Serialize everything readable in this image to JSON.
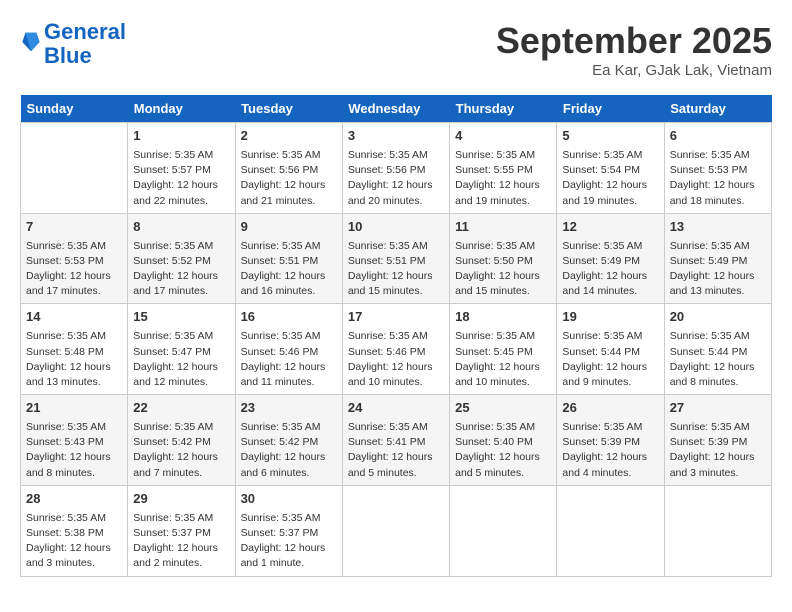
{
  "header": {
    "logo_line1": "General",
    "logo_line2": "Blue",
    "month": "September 2025",
    "location": "Ea Kar, GJak Lak, Vietnam"
  },
  "weekdays": [
    "Sunday",
    "Monday",
    "Tuesday",
    "Wednesday",
    "Thursday",
    "Friday",
    "Saturday"
  ],
  "weeks": [
    [
      {
        "day": "",
        "info": ""
      },
      {
        "day": "1",
        "info": "Sunrise: 5:35 AM\nSunset: 5:57 PM\nDaylight: 12 hours\nand 22 minutes."
      },
      {
        "day": "2",
        "info": "Sunrise: 5:35 AM\nSunset: 5:56 PM\nDaylight: 12 hours\nand 21 minutes."
      },
      {
        "day": "3",
        "info": "Sunrise: 5:35 AM\nSunset: 5:56 PM\nDaylight: 12 hours\nand 20 minutes."
      },
      {
        "day": "4",
        "info": "Sunrise: 5:35 AM\nSunset: 5:55 PM\nDaylight: 12 hours\nand 19 minutes."
      },
      {
        "day": "5",
        "info": "Sunrise: 5:35 AM\nSunset: 5:54 PM\nDaylight: 12 hours\nand 19 minutes."
      },
      {
        "day": "6",
        "info": "Sunrise: 5:35 AM\nSunset: 5:53 PM\nDaylight: 12 hours\nand 18 minutes."
      }
    ],
    [
      {
        "day": "7",
        "info": "Sunrise: 5:35 AM\nSunset: 5:53 PM\nDaylight: 12 hours\nand 17 minutes."
      },
      {
        "day": "8",
        "info": "Sunrise: 5:35 AM\nSunset: 5:52 PM\nDaylight: 12 hours\nand 17 minutes."
      },
      {
        "day": "9",
        "info": "Sunrise: 5:35 AM\nSunset: 5:51 PM\nDaylight: 12 hours\nand 16 minutes."
      },
      {
        "day": "10",
        "info": "Sunrise: 5:35 AM\nSunset: 5:51 PM\nDaylight: 12 hours\nand 15 minutes."
      },
      {
        "day": "11",
        "info": "Sunrise: 5:35 AM\nSunset: 5:50 PM\nDaylight: 12 hours\nand 15 minutes."
      },
      {
        "day": "12",
        "info": "Sunrise: 5:35 AM\nSunset: 5:49 PM\nDaylight: 12 hours\nand 14 minutes."
      },
      {
        "day": "13",
        "info": "Sunrise: 5:35 AM\nSunset: 5:49 PM\nDaylight: 12 hours\nand 13 minutes."
      }
    ],
    [
      {
        "day": "14",
        "info": "Sunrise: 5:35 AM\nSunset: 5:48 PM\nDaylight: 12 hours\nand 13 minutes."
      },
      {
        "day": "15",
        "info": "Sunrise: 5:35 AM\nSunset: 5:47 PM\nDaylight: 12 hours\nand 12 minutes."
      },
      {
        "day": "16",
        "info": "Sunrise: 5:35 AM\nSunset: 5:46 PM\nDaylight: 12 hours\nand 11 minutes."
      },
      {
        "day": "17",
        "info": "Sunrise: 5:35 AM\nSunset: 5:46 PM\nDaylight: 12 hours\nand 10 minutes."
      },
      {
        "day": "18",
        "info": "Sunrise: 5:35 AM\nSunset: 5:45 PM\nDaylight: 12 hours\nand 10 minutes."
      },
      {
        "day": "19",
        "info": "Sunrise: 5:35 AM\nSunset: 5:44 PM\nDaylight: 12 hours\nand 9 minutes."
      },
      {
        "day": "20",
        "info": "Sunrise: 5:35 AM\nSunset: 5:44 PM\nDaylight: 12 hours\nand 8 minutes."
      }
    ],
    [
      {
        "day": "21",
        "info": "Sunrise: 5:35 AM\nSunset: 5:43 PM\nDaylight: 12 hours\nand 8 minutes."
      },
      {
        "day": "22",
        "info": "Sunrise: 5:35 AM\nSunset: 5:42 PM\nDaylight: 12 hours\nand 7 minutes."
      },
      {
        "day": "23",
        "info": "Sunrise: 5:35 AM\nSunset: 5:42 PM\nDaylight: 12 hours\nand 6 minutes."
      },
      {
        "day": "24",
        "info": "Sunrise: 5:35 AM\nSunset: 5:41 PM\nDaylight: 12 hours\nand 5 minutes."
      },
      {
        "day": "25",
        "info": "Sunrise: 5:35 AM\nSunset: 5:40 PM\nDaylight: 12 hours\nand 5 minutes."
      },
      {
        "day": "26",
        "info": "Sunrise: 5:35 AM\nSunset: 5:39 PM\nDaylight: 12 hours\nand 4 minutes."
      },
      {
        "day": "27",
        "info": "Sunrise: 5:35 AM\nSunset: 5:39 PM\nDaylight: 12 hours\nand 3 minutes."
      }
    ],
    [
      {
        "day": "28",
        "info": "Sunrise: 5:35 AM\nSunset: 5:38 PM\nDaylight: 12 hours\nand 3 minutes."
      },
      {
        "day": "29",
        "info": "Sunrise: 5:35 AM\nSunset: 5:37 PM\nDaylight: 12 hours\nand 2 minutes."
      },
      {
        "day": "30",
        "info": "Sunrise: 5:35 AM\nSunset: 5:37 PM\nDaylight: 12 hours\nand 1 minute."
      },
      {
        "day": "",
        "info": ""
      },
      {
        "day": "",
        "info": ""
      },
      {
        "day": "",
        "info": ""
      },
      {
        "day": "",
        "info": ""
      }
    ]
  ]
}
